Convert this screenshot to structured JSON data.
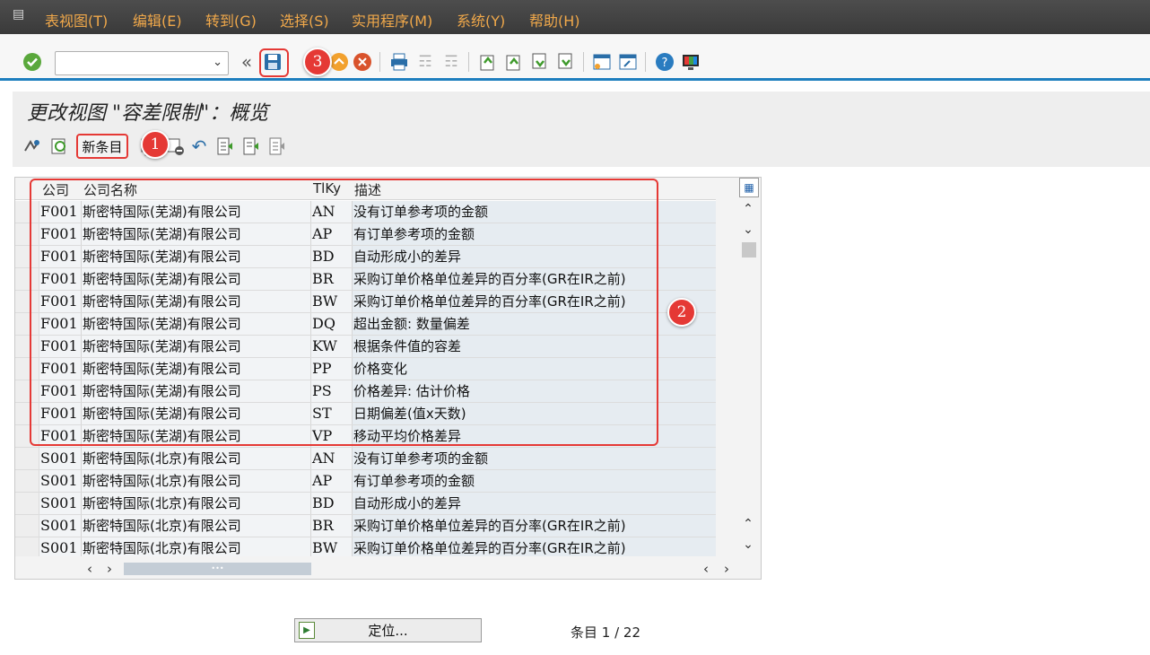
{
  "menubar": {
    "items": [
      "表视图(T)",
      "编辑(E)",
      "转到(G)",
      "选择(S)",
      "实用程序(M)",
      "系统(Y)",
      "帮助(H)"
    ]
  },
  "toolbar": {
    "command_value": "",
    "icons": [
      "check-icon",
      "back-arrows-icon",
      "save-icon",
      "back-icon",
      "exit-icon",
      "cancel-icon",
      "print-icon",
      "find-icon",
      "find-next-icon",
      "first-page-icon",
      "previous-page-icon",
      "next-page-icon",
      "last-page-icon",
      "create-session-icon",
      "shortcut-icon",
      "help-icon",
      "customize-layout-icon"
    ]
  },
  "title": "更改视图 \"容差限制\"：概览",
  "app_toolbar": {
    "new_entry_label": "新条目"
  },
  "table": {
    "columns": [
      "公司",
      "公司名称",
      "TlKy",
      "描述"
    ],
    "rows": [
      {
        "company": "F001",
        "name": "斯密特国际(芜湖)有限公司",
        "key": "AN",
        "desc": "没有订单参考项的金额"
      },
      {
        "company": "F001",
        "name": "斯密特国际(芜湖)有限公司",
        "key": "AP",
        "desc": "有订单参考项的金额"
      },
      {
        "company": "F001",
        "name": "斯密特国际(芜湖)有限公司",
        "key": "BD",
        "desc": "自动形成小的差异"
      },
      {
        "company": "F001",
        "name": "斯密特国际(芜湖)有限公司",
        "key": "BR",
        "desc": "采购订单价格单位差异的百分率(GR在IR之前)"
      },
      {
        "company": "F001",
        "name": "斯密特国际(芜湖)有限公司",
        "key": "BW",
        "desc": "采购订单价格单位差异的百分率(GR在IR之前)"
      },
      {
        "company": "F001",
        "name": "斯密特国际(芜湖)有限公司",
        "key": "DQ",
        "desc": "超出金额: 数量偏差"
      },
      {
        "company": "F001",
        "name": "斯密特国际(芜湖)有限公司",
        "key": "KW",
        "desc": "根据条件值的容差"
      },
      {
        "company": "F001",
        "name": "斯密特国际(芜湖)有限公司",
        "key": "PP",
        "desc": "价格变化"
      },
      {
        "company": "F001",
        "name": "斯密特国际(芜湖)有限公司",
        "key": "PS",
        "desc": "价格差异: 估计价格"
      },
      {
        "company": "F001",
        "name": "斯密特国际(芜湖)有限公司",
        "key": "ST",
        "desc": "日期偏差(值x天数)"
      },
      {
        "company": "F001",
        "name": "斯密特国际(芜湖)有限公司",
        "key": "VP",
        "desc": "移动平均价格差异"
      },
      {
        "company": "S001",
        "name": "斯密特国际(北京)有限公司",
        "key": "AN",
        "desc": "没有订单参考项的金额"
      },
      {
        "company": "S001",
        "name": "斯密特国际(北京)有限公司",
        "key": "AP",
        "desc": "有订单参考项的金额"
      },
      {
        "company": "S001",
        "name": "斯密特国际(北京)有限公司",
        "key": "BD",
        "desc": "自动形成小的差异"
      },
      {
        "company": "S001",
        "name": "斯密特国际(北京)有限公司",
        "key": "BR",
        "desc": "采购订单价格单位差异的百分率(GR在IR之前)"
      },
      {
        "company": "S001",
        "name": "斯密特国际(北京)有限公司",
        "key": "BW",
        "desc": "采购订单价格单位差异的百分率(GR在IR之前)"
      }
    ]
  },
  "footer": {
    "position_label": "定位...",
    "entry_count": "条目 1 / 22"
  },
  "callouts": [
    "1",
    "2",
    "3"
  ],
  "colors": {
    "menubar_bg": "#3f3f3f",
    "menu_text": "#f0a84a",
    "accent_blue": "#1e7fbf",
    "callout_red": "#e53935",
    "desc_cell_bg": "#e6ecf1"
  }
}
